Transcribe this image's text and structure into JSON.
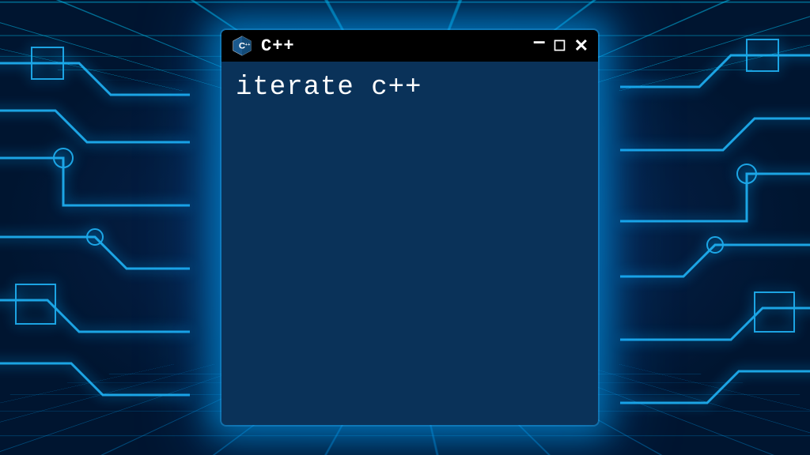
{
  "window": {
    "title": "C++",
    "content_text": "iterate c++"
  },
  "colors": {
    "window_bg": "#0a3259",
    "titlebar_bg": "#000000",
    "glow": "#00aaff",
    "text": "#ffffff"
  },
  "icons": {
    "app": "cpp-logo-icon",
    "minimize": "minimize-icon",
    "maximize": "maximize-icon",
    "close": "close-icon"
  }
}
